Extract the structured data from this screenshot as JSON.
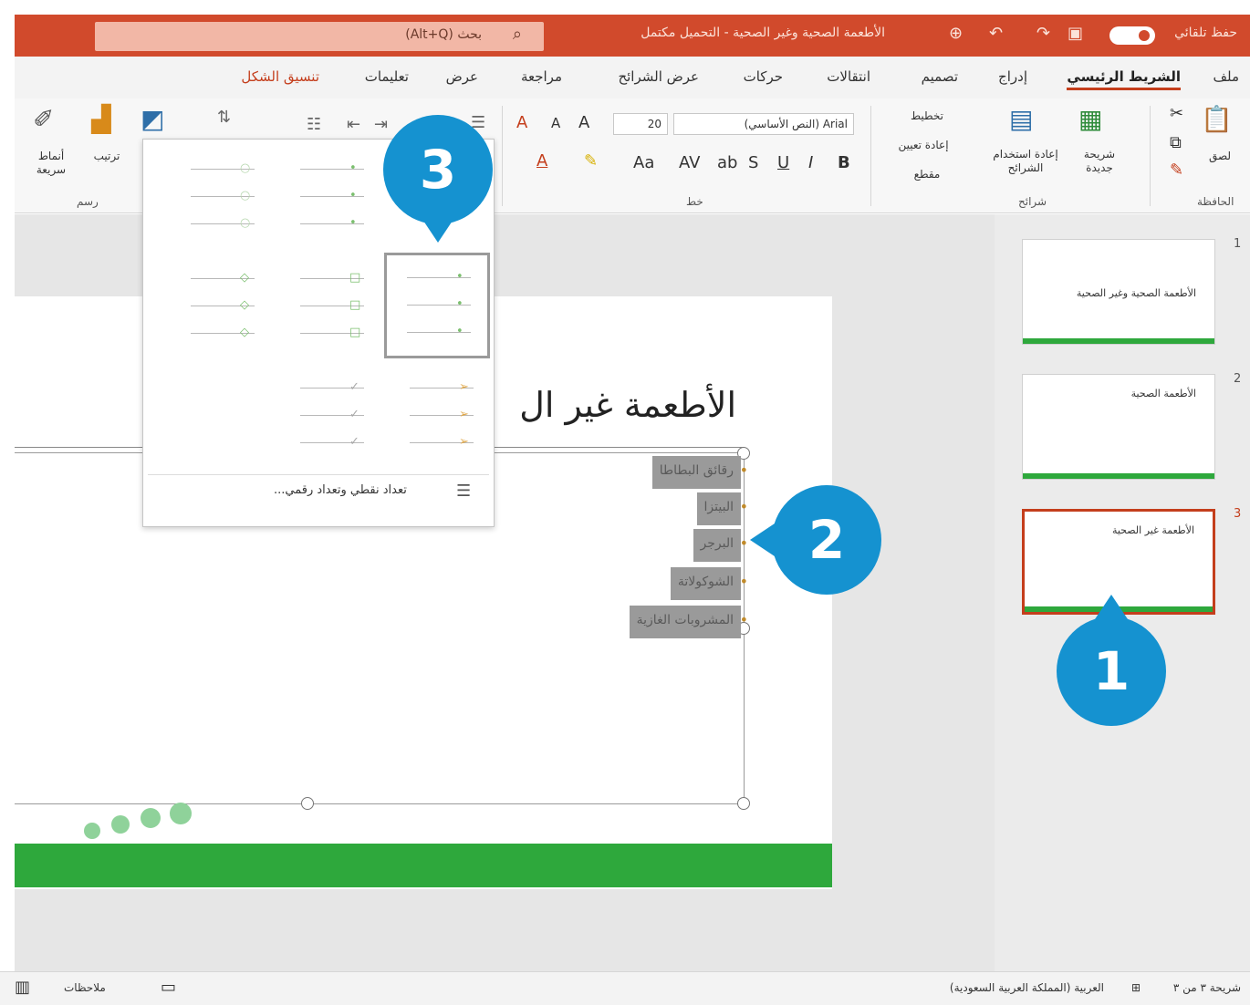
{
  "titlebar": {
    "autosave_label": "حفظ تلقائي",
    "doc_title": "الأطعمة الصحية وغير الصحية - التحميل مكتمل",
    "search_placeholder": "بحث (Alt+Q)",
    "accent_color": "#d14a2c"
  },
  "menu": {
    "tabs": [
      "ملف",
      "الشريط الرئيسي",
      "إدراج",
      "تصميم",
      "انتقالات",
      "حركات",
      "عرض الشرائح",
      "مراجعة",
      "عرض",
      "تعليمات",
      "تنسيق الشكل"
    ],
    "active_tab": "الشريط الرئيسي"
  },
  "ribbon": {
    "clipboard": {
      "paste": "لصق",
      "label": "الحافظة"
    },
    "slides": {
      "new_slide": "شريحة جديدة",
      "reuse": "إعادة استخدام الشرائح",
      "layout": "تخطيط",
      "reset": "إعادة تعيين",
      "section": "مقطع",
      "label": "شرائح"
    },
    "font": {
      "name": "Arial (النص الأساسي)",
      "size": "20",
      "label": "خط",
      "bold": "B",
      "italic": "I",
      "underline": "U",
      "strike": "S"
    },
    "drawing": {
      "shapes": "أشكال",
      "arrange": "ترتيب",
      "quick_styles": "أنماط سريعة",
      "label": "رسم"
    }
  },
  "slide": {
    "title": "الأطعمة غير ال",
    "bullets": [
      "رقائق البطاطا",
      "البيتزا",
      "البرجر",
      "الشوكولاتة",
      "المشروبات الغازية"
    ]
  },
  "thumbnails": [
    {
      "num": "1",
      "title": "الأطعمة الصحية وغير الصحية"
    },
    {
      "num": "2",
      "title": "الأطعمة الصحية"
    },
    {
      "num": "3",
      "title": "الأطعمة غير الصحية"
    }
  ],
  "dropdown": {
    "more_label": "تعداد نقطي وتعداد رقمي...",
    "selected_index": 0
  },
  "callouts": {
    "one": "1",
    "two": "2",
    "three": "3"
  },
  "statusbar": {
    "slide_count": "شريحة ٣ من ٣",
    "language": "العربية (المملكة العربية السعودية)",
    "notes": "ملاحظات"
  }
}
